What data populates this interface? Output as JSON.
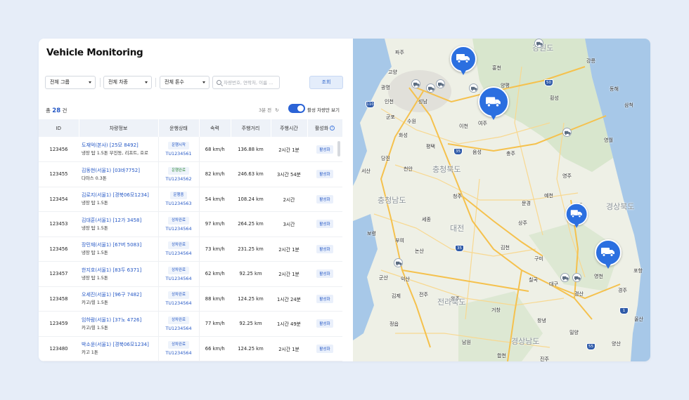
{
  "page": {
    "title": "Vehicle Monitoring"
  },
  "filters": {
    "group": "전체 그룹",
    "vehicle_type": "전체 차종",
    "tonnage": "전체 톤수",
    "search_placeholder": "차량번호, 연락처, 이름 ...",
    "query_button": "조회"
  },
  "summary": {
    "count_prefix": "총",
    "count": "28",
    "count_suffix": "건",
    "refresh": "3분 전",
    "active_only_label": "활성 차량만 보기",
    "active_only_on": true
  },
  "table": {
    "headers": [
      "ID",
      "차량정보",
      "운행상태",
      "속력",
      "주행거리",
      "주행시간",
      "활성화"
    ],
    "rows": [
      {
        "id": "123456",
        "driver": "도재억(본사)",
        "plate": "[25모 8492]",
        "vehicle": "냉장 탑 1.5톤 무진동, 리프트, 호로",
        "status": "운행시작",
        "tu": "TU1234561",
        "speed": "68 km/h",
        "distance": "136.88 km",
        "time": "2시간 1분",
        "active": "활성화"
      },
      {
        "id": "123455",
        "driver": "김동현(서울1)",
        "plate": "[03바7752]",
        "vehicle": "다마스 0.3톤",
        "status": "운행완료",
        "tu": "TU1234562",
        "speed": "82 km/h",
        "distance": "246.63 km",
        "time": "3시간 54분",
        "active": "활성화"
      },
      {
        "id": "123454",
        "driver": "김로지(서울1)",
        "plate": "[경북06모1234]",
        "vehicle": "냉장 탑 1.5톤",
        "status": "운행중",
        "tu": "TU1234563",
        "speed": "54 km/h",
        "distance": "108.24 km",
        "time": "2시간",
        "active": "활성화"
      },
      {
        "id": "123453",
        "driver": "김대훈(서울1)",
        "plate": "[12가 3458]",
        "vehicle": "냉장 탑 1.5톤",
        "status": "상차완료",
        "tu": "TU1234564",
        "speed": "97 km/h",
        "distance": "264.25 km",
        "time": "3시간",
        "active": "활성화"
      },
      {
        "id": "123456",
        "driver": "장민재(서울1)",
        "plate": "[67버 5083]",
        "vehicle": "냉장 탑 1.5톤",
        "status": "상차완료",
        "tu": "TU1234564",
        "speed": "73 km/h",
        "distance": "231.25 km",
        "time": "2시간 1분",
        "active": "활성화"
      },
      {
        "id": "123457",
        "driver": "한지호(서울1)",
        "plate": "[83두 6371]",
        "vehicle": "냉장 탑 1.5톤",
        "status": "상차완료",
        "tu": "TU1234564",
        "speed": "62 km/h",
        "distance": "92.25 km",
        "time": "2시간 1분",
        "active": "활성화"
      },
      {
        "id": "123458",
        "driver": "오세진(서울1)",
        "plate": "[96구 7482]",
        "vehicle": "카고/윙 1.5톤",
        "status": "상차완료",
        "tu": "TU1234564",
        "speed": "88 km/h",
        "distance": "124.25 km",
        "time": "1시간 24분",
        "active": "활성화"
      },
      {
        "id": "123459",
        "driver": "임하람(서울1)",
        "plate": "[37노 4726]",
        "vehicle": "카고/윙 1.5톤",
        "status": "상차완료",
        "tu": "TU1234564",
        "speed": "77 km/h",
        "distance": "92.25 km",
        "time": "1시간 49분",
        "active": "활성화"
      },
      {
        "id": "123480",
        "driver": "박소윤(서울1)",
        "plate": "[경북06모1234]",
        "vehicle": "카고 1톤",
        "status": "상차완료",
        "tu": "TU1234564",
        "speed": "66 km/h",
        "distance": "124.25 km",
        "time": "2시간 1분",
        "active": "활성화"
      }
    ]
  },
  "map": {
    "places": [
      "강원도",
      "파주",
      "가평",
      "고양",
      "홍천",
      "강릉",
      "광명",
      "양평",
      "동해",
      "인천",
      "성남",
      "횡성",
      "삼척",
      "군포",
      "원주",
      "수원",
      "이천",
      "화성",
      "여주",
      "영월",
      "평택",
      "충주",
      "당진",
      "서산",
      "천안",
      "음성",
      "충청북도",
      "영주",
      "청주",
      "충청남도",
      "예천",
      "세종",
      "대전",
      "문경",
      "안동",
      "경상북도",
      "상주",
      "보령",
      "부여",
      "논산",
      "김천",
      "구미",
      "포항",
      "군산",
      "익산",
      "칠곡",
      "영천",
      "대구",
      "경주",
      "김제",
      "전주",
      "완주",
      "경산",
      "전라북도",
      "울산",
      "거창",
      "창녕",
      "정읍",
      "밀양",
      "양산",
      "남원",
      "경상남도",
      "합천",
      "진주"
    ],
    "shields": [
      "110",
      "50",
      "35",
      "35",
      "1",
      "55"
    ],
    "colors": {
      "road_main": "#f5c14d",
      "road_minor": "#f8d890",
      "water": "#a7c8e8",
      "green": "#cfe1c2",
      "marker": "#2b6fe0"
    }
  },
  "colors": {
    "accent": "#2457c5",
    "background": "#e6edf8"
  }
}
